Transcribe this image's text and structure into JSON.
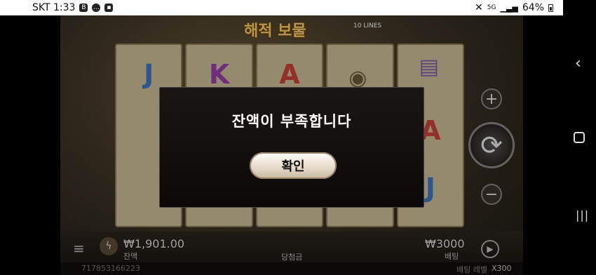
{
  "status_bar": {
    "carrier_time": "SKT 1:33",
    "network": "5G",
    "battery": "64%"
  },
  "game": {
    "title": "해적 보물",
    "title_sub": "10 LINES",
    "reel_symbols": [
      [
        "J"
      ],
      [
        "K"
      ],
      [
        "A"
      ],
      [],
      [
        "A",
        "J"
      ]
    ],
    "balance_value": "₩1,901.00",
    "balance_label": "잔액",
    "win_label": "당첨금",
    "bet_value": "₩3000",
    "bet_label": "배팅",
    "round_id": "717853166223",
    "bet_level_label": "배팅 레벨",
    "multiplier": "X300"
  },
  "dialog": {
    "message": "잔액이 부족합니다",
    "ok_label": "확인"
  },
  "nav": {
    "back": "‹",
    "recent": "|||"
  },
  "colors": {
    "dialog_bg": "#0b0908",
    "button_bg": "#e8dccb",
    "title_gold": "#f5d36a"
  }
}
